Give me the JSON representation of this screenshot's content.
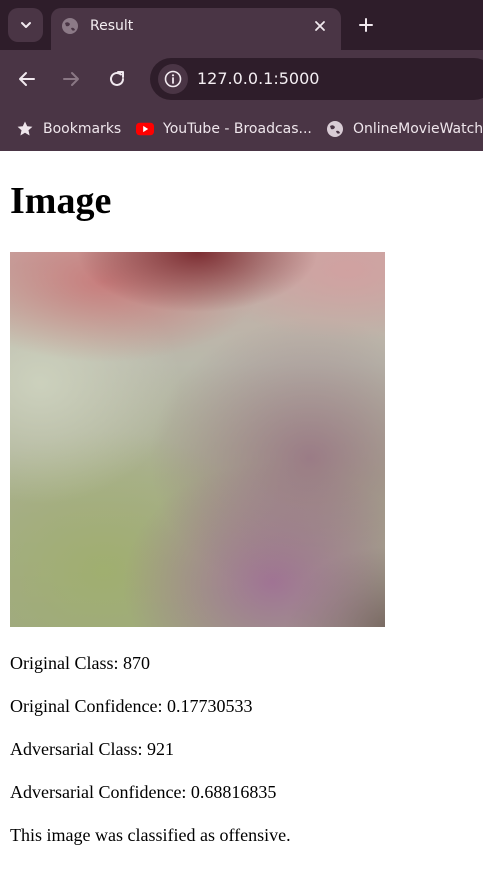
{
  "browser": {
    "tab": {
      "title": "Result",
      "favicon": "globe-icon"
    },
    "address_bar": {
      "url": "127.0.0.1:5000"
    },
    "bookmarks": [
      {
        "label": "Bookmarks",
        "icon": "star-icon"
      },
      {
        "label": "YouTube - Broadcas...",
        "icon": "youtube-icon"
      },
      {
        "label": "OnlineMovieWatchs",
        "icon": "globe-icon"
      }
    ],
    "colors": {
      "frame": "#2e1d2a",
      "toolbar": "#4a3545",
      "youtube_red": "#ff0000"
    }
  },
  "page": {
    "heading": "Image",
    "image_icon": "result-image",
    "lines": {
      "original_class": "Original Class: 870",
      "original_confidence": "Original Confidence: 0.17730533",
      "adversarial_class": "Adversarial Class: 921",
      "adversarial_confidence": "Adversarial Confidence: 0.68816835",
      "verdict": "This image was classified as offensive."
    }
  }
}
